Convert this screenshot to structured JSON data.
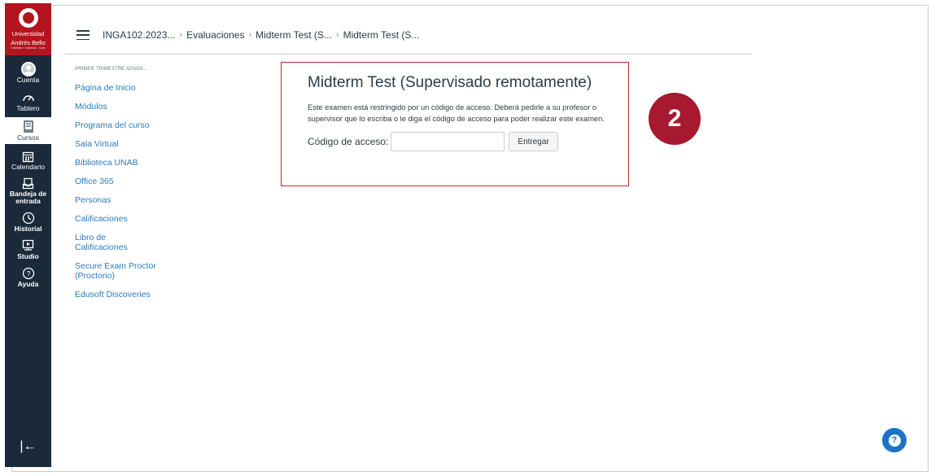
{
  "university": {
    "name_line1": "Universidad",
    "name_line2": "Andrés Bello",
    "tagline": "Científica · Inclusiva · Líder"
  },
  "global_nav": [
    {
      "label": "Cuenta",
      "icon": "account-icon"
    },
    {
      "label": "Tablero",
      "icon": "dashboard-icon"
    },
    {
      "label": "Cursos",
      "icon": "courses-icon"
    },
    {
      "label": "Calendario",
      "icon": "calendar-icon"
    },
    {
      "label": "Bandeja de entrada",
      "icon": "inbox-icon"
    },
    {
      "label": "Historial",
      "icon": "history-icon"
    },
    {
      "label": "Studio",
      "icon": "studio-icon"
    },
    {
      "label": "Ayuda",
      "icon": "help-icon"
    }
  ],
  "collapse_glyph": "|←",
  "breadcrumb": [
    "INGA102.2023...",
    "Evaluaciones",
    "Midterm Test (S...",
    "Midterm Test (S..."
  ],
  "course_nav": {
    "term": "PRIMER TRIMESTRE ADVAN...",
    "items": [
      "Página de Inicio",
      "Módulos",
      "Programa del curso",
      "Sala Virtual",
      "Biblioteca UNAB",
      "Office 365",
      "Personas",
      "Calificaciones",
      "Libro de Calificaciones",
      "Secure Exam Proctor (Proctorio)",
      "Edusoft Discoveries"
    ]
  },
  "exam": {
    "title": "Midterm Test (Supervisado remotamente)",
    "description": "Este examen está restringido por un código de acceso. Deberá pedirle a su profesor o supervisor que lo escriba o le diga el código de acceso para poder realizar este examen.",
    "code_label": "Código de acceso:",
    "code_value": "",
    "submit_label": "Entregar"
  },
  "step_badge": "2",
  "colors": {
    "nav_bg": "#1b2a3a",
    "brand_red": "#b3141d",
    "link": "#2b7abc",
    "highlight": "#c1272d",
    "help_blue": "#1a73c9"
  }
}
